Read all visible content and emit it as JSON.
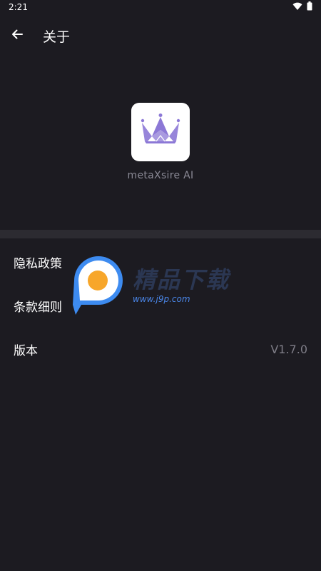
{
  "status_bar": {
    "time": "2:21",
    "icons": [
      "wifi-icon",
      "battery-icon"
    ]
  },
  "app_bar": {
    "back_icon": "arrow-left-icon",
    "title": "关于"
  },
  "app_info": {
    "icon": "crown-icon",
    "icon_color": "#8c78d6",
    "name": "metaXsire AI"
  },
  "menu": {
    "items": [
      {
        "label": "隐私政策",
        "value": ""
      },
      {
        "label": "条款细则",
        "value": ""
      },
      {
        "label": "版本",
        "value": "V1.7.0"
      }
    ]
  },
  "watermark": {
    "title": "精品下载",
    "url": "www.j9p.com",
    "logo_colors": {
      "blue": "#3d8bf0",
      "orange": "#f7a62a"
    }
  },
  "colors": {
    "background": "#1c1b21",
    "divider": "#2c2b31",
    "text_primary": "#ffffff",
    "text_secondary": "#8b8a96"
  }
}
